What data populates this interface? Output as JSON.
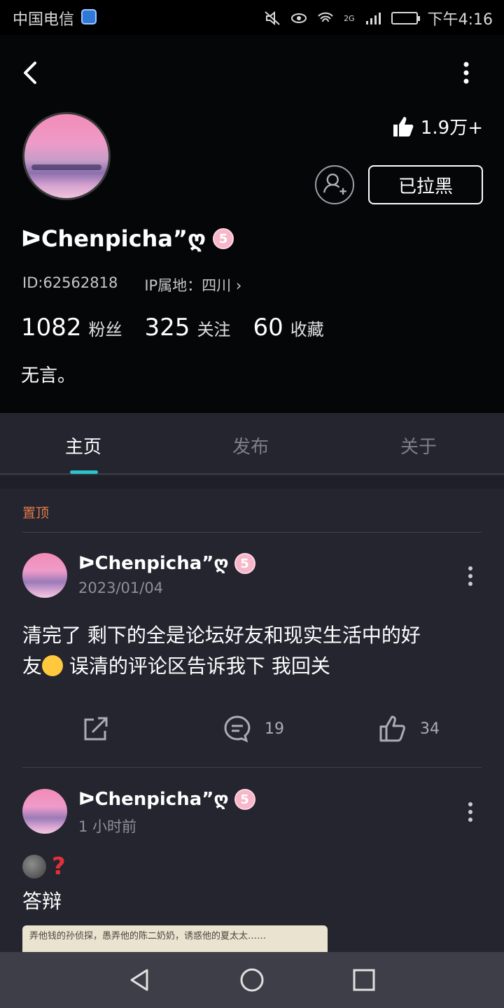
{
  "status_bar": {
    "carrier": "中国电信",
    "network": "2G",
    "time": "下午4:16"
  },
  "profile": {
    "likes_total": "1.9万+",
    "blocked_label": "已拉黑",
    "name": "ᐅChenpicha”ღ",
    "level": "5",
    "id_text": "ID:62562818",
    "ip_text": "IP属地：四川",
    "stats": [
      {
        "value": "1082",
        "label": "粉丝"
      },
      {
        "value": "325",
        "label": "关注"
      },
      {
        "value": "60",
        "label": "收藏"
      }
    ],
    "bio": "无言。"
  },
  "tabs": [
    "主页",
    "发布",
    "关于"
  ],
  "pinned_label": "置顶",
  "posts": [
    {
      "author": "ᐅChenpicha”ღ",
      "level": "5",
      "time": "2023/01/04",
      "text_line1": "清完了 剩下的全是论坛好友和现实生活中的好",
      "text_line2_a": "友",
      "text_line2_b": " 误清的评论区告诉我下 我回关",
      "comments": "19",
      "likes": "34"
    },
    {
      "author": "ᐅChenpicha”ღ",
      "level": "5",
      "time": "1 小时前",
      "text": "答辩",
      "image_text": "弄他钱的孙侦探，愚弄他的陈二奶奶，诱惑他的夏太太……"
    }
  ],
  "colors": {
    "accent": "#2cc3cc",
    "pin": "#e27a4a",
    "background": "#24252f",
    "header": "#050608"
  }
}
